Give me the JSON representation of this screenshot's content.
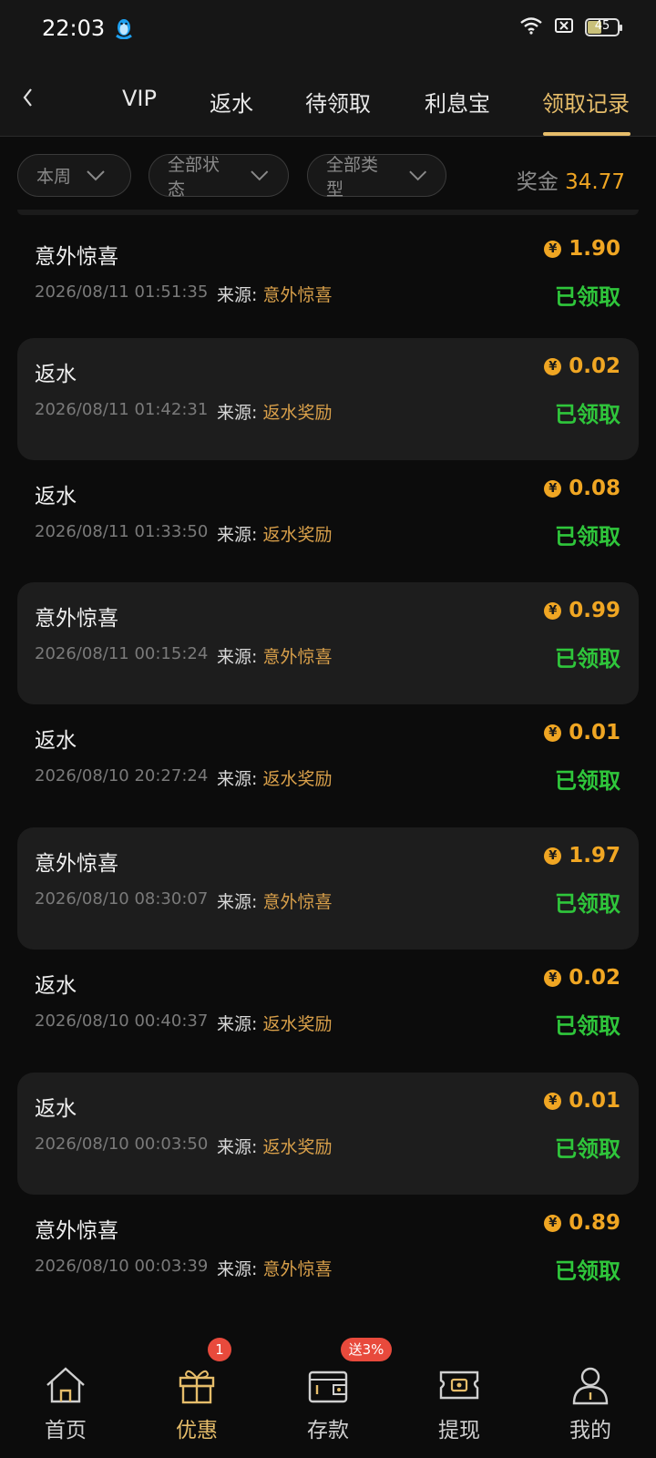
{
  "status_bar": {
    "time": "22:03",
    "battery": "45"
  },
  "tabs": {
    "items": [
      {
        "label": "VIP"
      },
      {
        "label": "返水"
      },
      {
        "label": "待领取"
      },
      {
        "label": "利息宝"
      },
      {
        "label": "领取记录"
      }
    ],
    "active_index": 4,
    "accent_color": "#e6bd6a"
  },
  "filters": {
    "period": "本周",
    "status": "全部状态",
    "type": "全部类型",
    "bonus_label": "奖金",
    "bonus_value": "34.77"
  },
  "records": [
    {
      "title": "意外惊喜",
      "time": "2026/08/11 01:51:35",
      "source_label": "来源:",
      "source": "意外惊喜",
      "amount": "1.90",
      "currency_icon": "¥",
      "status": "已领取"
    },
    {
      "title": "返水",
      "time": "2026/08/11 01:42:31",
      "source_label": "来源:",
      "source": "返水奖励",
      "amount": "0.02",
      "currency_icon": "¥",
      "status": "已领取"
    },
    {
      "title": "返水",
      "time": "2026/08/11 01:33:50",
      "source_label": "来源:",
      "source": "返水奖励",
      "amount": "0.08",
      "currency_icon": "¥",
      "status": "已领取"
    },
    {
      "title": "意外惊喜",
      "time": "2026/08/11 00:15:24",
      "source_label": "来源:",
      "source": "意外惊喜",
      "amount": "0.99",
      "currency_icon": "¥",
      "status": "已领取"
    },
    {
      "title": "返水",
      "time": "2026/08/10 20:27:24",
      "source_label": "来源:",
      "source": "返水奖励",
      "amount": "0.01",
      "currency_icon": "¥",
      "status": "已领取"
    },
    {
      "title": "意外惊喜",
      "time": "2026/08/10 08:30:07",
      "source_label": "来源:",
      "source": "意外惊喜",
      "amount": "1.97",
      "currency_icon": "¥",
      "status": "已领取"
    },
    {
      "title": "返水",
      "time": "2026/08/10 00:40:37",
      "source_label": "来源:",
      "source": "返水奖励",
      "amount": "0.02",
      "currency_icon": "¥",
      "status": "已领取"
    },
    {
      "title": "返水",
      "time": "2026/08/10 00:03:50",
      "source_label": "来源:",
      "source": "返水奖励",
      "amount": "0.01",
      "currency_icon": "¥",
      "status": "已领取"
    },
    {
      "title": "意外惊喜",
      "time": "2026/08/10 00:03:39",
      "source_label": "来源:",
      "source": "意外惊喜",
      "amount": "0.89",
      "currency_icon": "¥",
      "status": "已领取"
    }
  ],
  "bottom_nav": {
    "items": [
      {
        "label": "首页",
        "icon": "home-icon"
      },
      {
        "label": "优惠",
        "icon": "gift-icon",
        "badge": "1"
      },
      {
        "label": "存款",
        "icon": "wallet-icon",
        "badge": "送3%"
      },
      {
        "label": "提现",
        "icon": "withdraw-ticket-icon"
      },
      {
        "label": "我的",
        "icon": "profile-icon"
      }
    ],
    "active_index": 1
  },
  "colors": {
    "gold": "#e6bd6a",
    "amount": "#f0a623",
    "claimed": "#2fc63b",
    "badge": "#e84a3c"
  }
}
